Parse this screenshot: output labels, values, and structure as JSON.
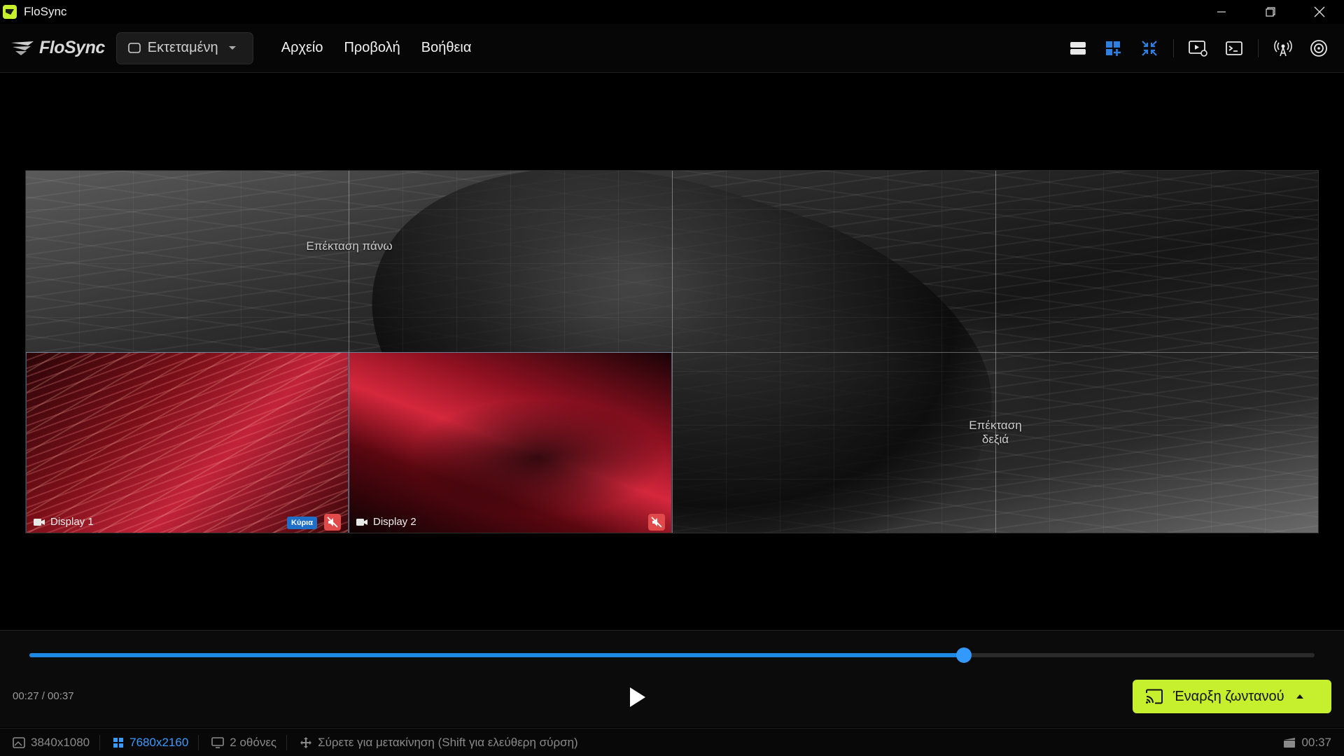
{
  "window": {
    "title": "FloSync"
  },
  "header": {
    "logo": "FloSync",
    "mode_select": {
      "value": "Εκτεταμένη"
    },
    "menu": [
      "Αρχείο",
      "Προβολή",
      "Βοήθεια"
    ],
    "tools": [
      "layout-list-icon",
      "layout-grid-add-icon",
      "collapse-icon",
      "preview-settings-icon",
      "console-icon",
      "broadcast-icon",
      "stream-icon"
    ],
    "accent": "#2f7fe0"
  },
  "canvas": {
    "region_top": "Επέκταση πάνω",
    "region_right": "Επέκταση δεξιά",
    "displays": [
      {
        "name": "Display 1",
        "badge": "Κύρια",
        "muted": true
      },
      {
        "name": "Display 2",
        "muted": true
      }
    ]
  },
  "timeline": {
    "current": "00:27",
    "total": "00:37",
    "time_display": "00:27 / 00:37",
    "progress": 0.727,
    "go_live_label": "Έναρξη ζωντανού",
    "go_live_color": "#c6f02d"
  },
  "status": {
    "resolution": "3840x1080",
    "canvas_resolution": "7680x2160",
    "screens": "2 οθόνες",
    "hint": "Σύρετε για μετακίνηση (Shift για ελεύθερη σύρση)",
    "duration": "00:37"
  }
}
